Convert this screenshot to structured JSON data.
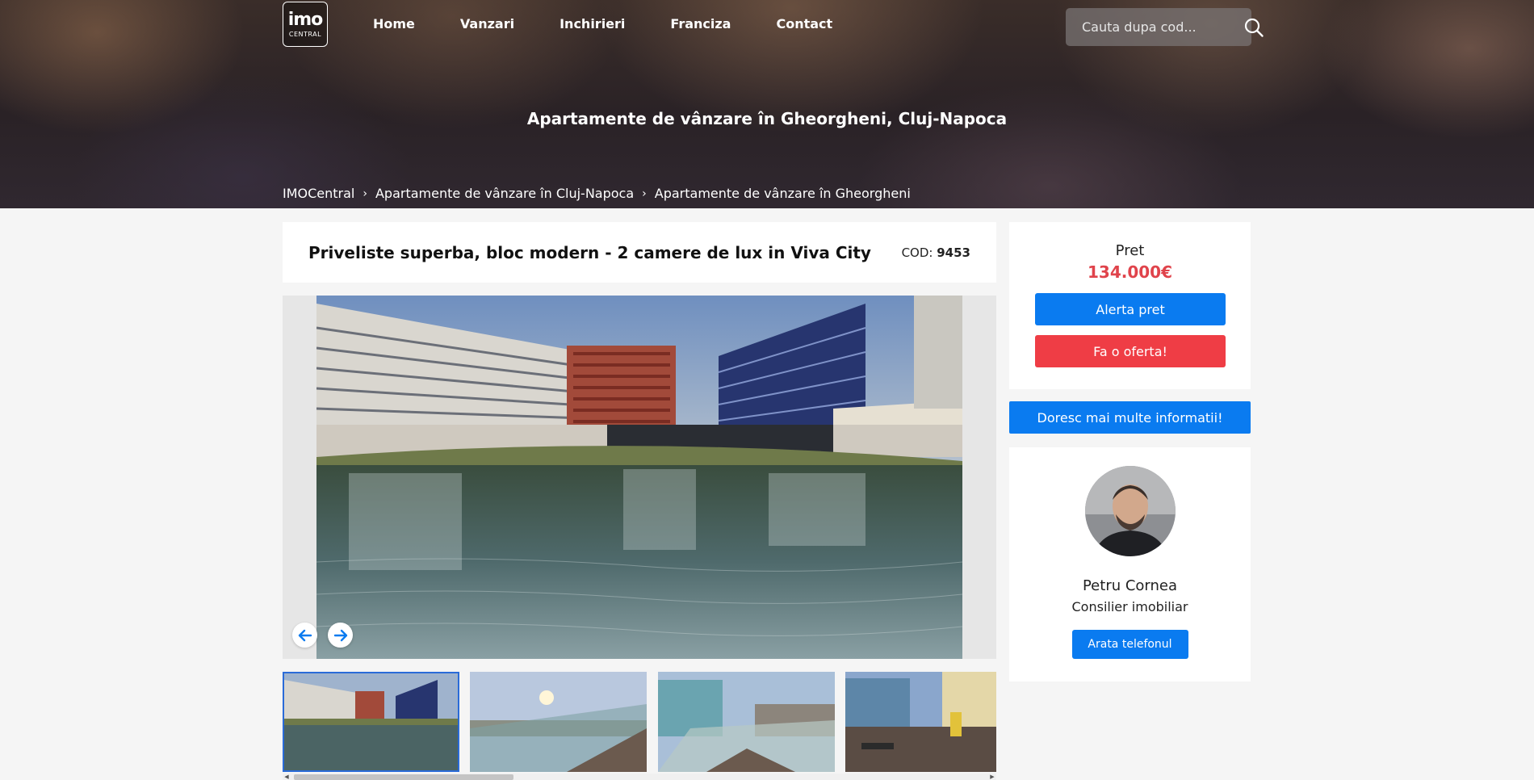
{
  "header": {
    "logo": {
      "main": "imo",
      "sub": "CENTRAL"
    },
    "nav": [
      {
        "label": "Home"
      },
      {
        "label": "Vanzari"
      },
      {
        "label": "Inchirieri"
      },
      {
        "label": "Franciza"
      },
      {
        "label": "Contact"
      }
    ],
    "search": {
      "placeholder": "Cauta dupa cod...",
      "icon": "search-icon"
    }
  },
  "hero": {
    "title": "Apartamente de vânzare în Gheorgheni, Cluj-Napoca",
    "breadcrumb": [
      {
        "label": "IMOCentral"
      },
      {
        "label": "Apartamente de vânzare în Cluj-Napoca"
      },
      {
        "label": "Apartamente de vânzare în Gheorgheni"
      }
    ],
    "breadcrumb_separator": "›"
  },
  "listing": {
    "title": "Priveliste superba, bloc modern - 2 camere de lux in Viva City",
    "code_label": "COD:",
    "code_value": "9453",
    "gallery": {
      "prev_icon": "arrow-left-icon",
      "next_icon": "arrow-right-icon",
      "thumbnails": [
        {
          "name": "thumb-lake",
          "active": true
        },
        {
          "name": "thumb-balcony-sunset",
          "active": false
        },
        {
          "name": "thumb-balcony-railing",
          "active": false
        },
        {
          "name": "thumb-playground",
          "active": false
        }
      ]
    }
  },
  "sidebar": {
    "price_label": "Pret",
    "price_value": "134.000€",
    "alert_button": "Alerta pret",
    "offer_button": "Fa o oferta!",
    "info_button": "Doresc mai multe informatii!",
    "agent": {
      "name": "Petru Cornea",
      "role": "Consilier imobiliar",
      "phone_button": "Arata telefonul"
    }
  },
  "colors": {
    "accent_blue": "#0a7bf0",
    "accent_red": "#ef3d45",
    "price_red": "#e0434b"
  }
}
